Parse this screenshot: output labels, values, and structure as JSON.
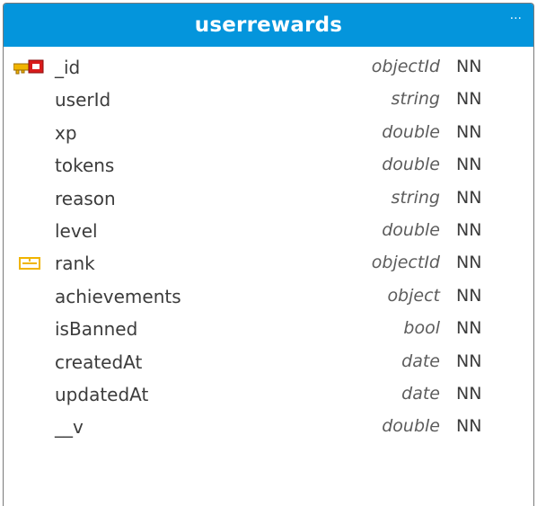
{
  "entity": {
    "title": "userrewards",
    "menu_label": "···",
    "fields": [
      {
        "name": "_id",
        "type": "objectId",
        "constraint": "NN",
        "icon": "primary-key-icon"
      },
      {
        "name": "userId",
        "type": "string",
        "constraint": "NN",
        "icon": ""
      },
      {
        "name": "xp",
        "type": "double",
        "constraint": "NN",
        "icon": ""
      },
      {
        "name": "tokens",
        "type": "double",
        "constraint": "NN",
        "icon": ""
      },
      {
        "name": "reason",
        "type": "string",
        "constraint": "NN",
        "icon": ""
      },
      {
        "name": "level",
        "type": "double",
        "constraint": "NN",
        "icon": ""
      },
      {
        "name": "rank",
        "type": "objectId",
        "constraint": "NN",
        "icon": "foreign-key-icon"
      },
      {
        "name": "achievements",
        "type": "object",
        "constraint": "NN",
        "icon": ""
      },
      {
        "name": "isBanned",
        "type": "bool",
        "constraint": "NN",
        "icon": ""
      },
      {
        "name": "createdAt",
        "type": "date",
        "constraint": "NN",
        "icon": ""
      },
      {
        "name": "updatedAt",
        "type": "date",
        "constraint": "NN",
        "icon": ""
      },
      {
        "name": "__v",
        "type": "double",
        "constraint": "NN",
        "icon": ""
      }
    ]
  },
  "colors": {
    "header": "#0495dc",
    "primary_key": "#d81b1b",
    "key_gold": "#f0b400"
  }
}
